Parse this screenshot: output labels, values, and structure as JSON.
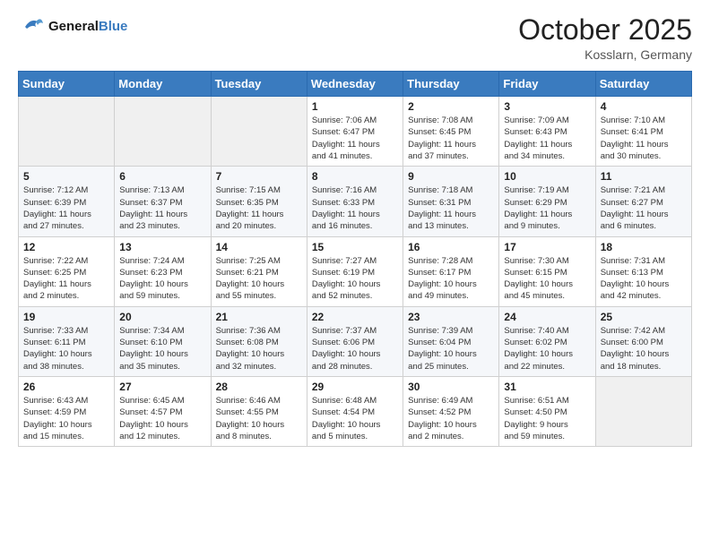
{
  "header": {
    "logo_general": "General",
    "logo_blue": "Blue",
    "month": "October 2025",
    "location": "Kosslarn, Germany"
  },
  "weekdays": [
    "Sunday",
    "Monday",
    "Tuesday",
    "Wednesday",
    "Thursday",
    "Friday",
    "Saturday"
  ],
  "weeks": [
    [
      {
        "day": "",
        "info": ""
      },
      {
        "day": "",
        "info": ""
      },
      {
        "day": "",
        "info": ""
      },
      {
        "day": "1",
        "info": "Sunrise: 7:06 AM\nSunset: 6:47 PM\nDaylight: 11 hours\nand 41 minutes."
      },
      {
        "day": "2",
        "info": "Sunrise: 7:08 AM\nSunset: 6:45 PM\nDaylight: 11 hours\nand 37 minutes."
      },
      {
        "day": "3",
        "info": "Sunrise: 7:09 AM\nSunset: 6:43 PM\nDaylight: 11 hours\nand 34 minutes."
      },
      {
        "day": "4",
        "info": "Sunrise: 7:10 AM\nSunset: 6:41 PM\nDaylight: 11 hours\nand 30 minutes."
      }
    ],
    [
      {
        "day": "5",
        "info": "Sunrise: 7:12 AM\nSunset: 6:39 PM\nDaylight: 11 hours\nand 27 minutes."
      },
      {
        "day": "6",
        "info": "Sunrise: 7:13 AM\nSunset: 6:37 PM\nDaylight: 11 hours\nand 23 minutes."
      },
      {
        "day": "7",
        "info": "Sunrise: 7:15 AM\nSunset: 6:35 PM\nDaylight: 11 hours\nand 20 minutes."
      },
      {
        "day": "8",
        "info": "Sunrise: 7:16 AM\nSunset: 6:33 PM\nDaylight: 11 hours\nand 16 minutes."
      },
      {
        "day": "9",
        "info": "Sunrise: 7:18 AM\nSunset: 6:31 PM\nDaylight: 11 hours\nand 13 minutes."
      },
      {
        "day": "10",
        "info": "Sunrise: 7:19 AM\nSunset: 6:29 PM\nDaylight: 11 hours\nand 9 minutes."
      },
      {
        "day": "11",
        "info": "Sunrise: 7:21 AM\nSunset: 6:27 PM\nDaylight: 11 hours\nand 6 minutes."
      }
    ],
    [
      {
        "day": "12",
        "info": "Sunrise: 7:22 AM\nSunset: 6:25 PM\nDaylight: 11 hours\nand 2 minutes."
      },
      {
        "day": "13",
        "info": "Sunrise: 7:24 AM\nSunset: 6:23 PM\nDaylight: 10 hours\nand 59 minutes."
      },
      {
        "day": "14",
        "info": "Sunrise: 7:25 AM\nSunset: 6:21 PM\nDaylight: 10 hours\nand 55 minutes."
      },
      {
        "day": "15",
        "info": "Sunrise: 7:27 AM\nSunset: 6:19 PM\nDaylight: 10 hours\nand 52 minutes."
      },
      {
        "day": "16",
        "info": "Sunrise: 7:28 AM\nSunset: 6:17 PM\nDaylight: 10 hours\nand 49 minutes."
      },
      {
        "day": "17",
        "info": "Sunrise: 7:30 AM\nSunset: 6:15 PM\nDaylight: 10 hours\nand 45 minutes."
      },
      {
        "day": "18",
        "info": "Sunrise: 7:31 AM\nSunset: 6:13 PM\nDaylight: 10 hours\nand 42 minutes."
      }
    ],
    [
      {
        "day": "19",
        "info": "Sunrise: 7:33 AM\nSunset: 6:11 PM\nDaylight: 10 hours\nand 38 minutes."
      },
      {
        "day": "20",
        "info": "Sunrise: 7:34 AM\nSunset: 6:10 PM\nDaylight: 10 hours\nand 35 minutes."
      },
      {
        "day": "21",
        "info": "Sunrise: 7:36 AM\nSunset: 6:08 PM\nDaylight: 10 hours\nand 32 minutes."
      },
      {
        "day": "22",
        "info": "Sunrise: 7:37 AM\nSunset: 6:06 PM\nDaylight: 10 hours\nand 28 minutes."
      },
      {
        "day": "23",
        "info": "Sunrise: 7:39 AM\nSunset: 6:04 PM\nDaylight: 10 hours\nand 25 minutes."
      },
      {
        "day": "24",
        "info": "Sunrise: 7:40 AM\nSunset: 6:02 PM\nDaylight: 10 hours\nand 22 minutes."
      },
      {
        "day": "25",
        "info": "Sunrise: 7:42 AM\nSunset: 6:00 PM\nDaylight: 10 hours\nand 18 minutes."
      }
    ],
    [
      {
        "day": "26",
        "info": "Sunrise: 6:43 AM\nSunset: 4:59 PM\nDaylight: 10 hours\nand 15 minutes."
      },
      {
        "day": "27",
        "info": "Sunrise: 6:45 AM\nSunset: 4:57 PM\nDaylight: 10 hours\nand 12 minutes."
      },
      {
        "day": "28",
        "info": "Sunrise: 6:46 AM\nSunset: 4:55 PM\nDaylight: 10 hours\nand 8 minutes."
      },
      {
        "day": "29",
        "info": "Sunrise: 6:48 AM\nSunset: 4:54 PM\nDaylight: 10 hours\nand 5 minutes."
      },
      {
        "day": "30",
        "info": "Sunrise: 6:49 AM\nSunset: 4:52 PM\nDaylight: 10 hours\nand 2 minutes."
      },
      {
        "day": "31",
        "info": "Sunrise: 6:51 AM\nSunset: 4:50 PM\nDaylight: 9 hours\nand 59 minutes."
      },
      {
        "day": "",
        "info": ""
      }
    ]
  ]
}
